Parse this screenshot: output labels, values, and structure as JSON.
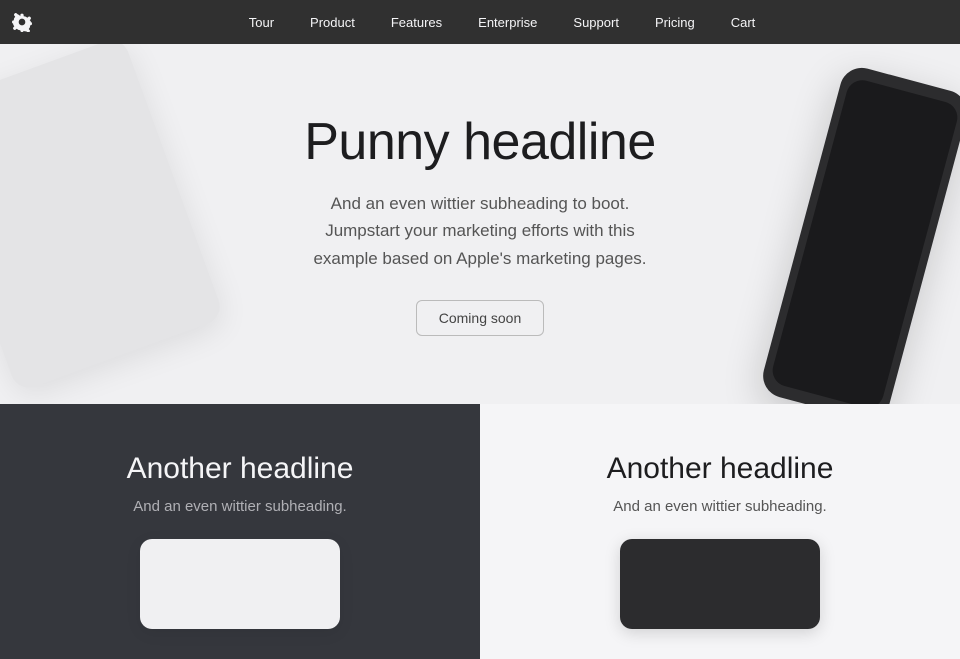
{
  "nav": {
    "logo_label": "logo",
    "links": [
      {
        "id": "tour",
        "label": "Tour"
      },
      {
        "id": "product",
        "label": "Product"
      },
      {
        "id": "features",
        "label": "Features"
      },
      {
        "id": "enterprise",
        "label": "Enterprise"
      },
      {
        "id": "support",
        "label": "Support"
      },
      {
        "id": "pricing",
        "label": "Pricing"
      },
      {
        "id": "cart",
        "label": "Cart"
      }
    ]
  },
  "hero": {
    "title": "Punny headline",
    "subtitle": "And an even wittier subheading to boot. Jumpstart your marketing efforts with this example based on Apple's marketing pages.",
    "cta_label": "Coming soon"
  },
  "bottom": {
    "left": {
      "title": "Another headline",
      "subtitle": "And an even wittier subheading."
    },
    "right": {
      "title": "Another headline",
      "subtitle": "And an even wittier subheading."
    }
  }
}
